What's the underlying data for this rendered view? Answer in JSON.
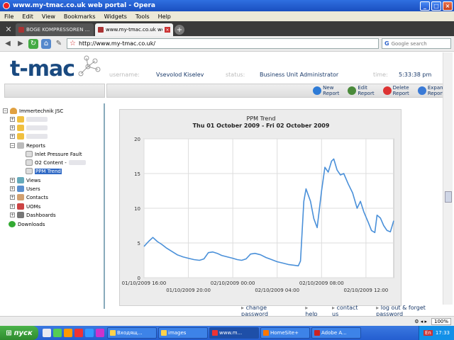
{
  "window": {
    "title": "www.my-tmac.co.uk web portal - Opera"
  },
  "menu": [
    "File",
    "Edit",
    "View",
    "Bookmarks",
    "Widgets",
    "Tools",
    "Help"
  ],
  "tabs": [
    {
      "label": "BOGE KOMPRESSOREN ..."
    },
    {
      "label": "www.my-tmac.co.uk we..."
    }
  ],
  "address": {
    "url": "http://www.my-tmac.co.uk/",
    "search_placeholder": "Google search"
  },
  "header": {
    "logo": "t-mac",
    "username_label": "username:",
    "username": "Vsevolod Kiselev",
    "status_label": "status:",
    "status": "Business Unit Administrator",
    "time_label": "time:",
    "time": "5:33:38 pm"
  },
  "actions": [
    {
      "l1": "New",
      "l2": "Report",
      "color": "#2e7bd6"
    },
    {
      "l1": "Edit",
      "l2": "Report",
      "color": "#4a8a3a"
    },
    {
      "l1": "Delete",
      "l2": "Report",
      "color": "#d33"
    },
    {
      "l1": "Expand",
      "l2": "Report",
      "color": "#3a7ad6"
    }
  ],
  "tree": {
    "root": "Immertechnik JSC",
    "reports": "Reports",
    "report_items": [
      "Inlet Pressure Fault",
      "O2 Content -",
      "PPM Trend"
    ],
    "views": "Views",
    "users": "Users",
    "contacts": "Contacts",
    "uoms": "UOMs",
    "dashboards": "Dashboards",
    "downloads": "Downloads"
  },
  "chart_data": {
    "type": "line",
    "title": "PPM Trend",
    "subtitle": "Thu 01 October 2009 - Fri 02 October 2009",
    "xlabel": "",
    "ylabel": "",
    "ylim": [
      0,
      20
    ],
    "yticks": [
      0,
      5,
      10,
      15,
      20
    ],
    "xticks_top": [
      "01/10/2009 16:00",
      "02/10/2009 00:00",
      "02/10/2009 08:00"
    ],
    "xticks_bottom": [
      "01/10/2009 20:00",
      "02/10/2009 04:00",
      "02/10/2009 12:00"
    ],
    "xtick_hours": [
      16,
      20,
      24,
      28,
      32,
      36
    ],
    "xrange_hours": [
      16,
      38.5
    ],
    "grid": true,
    "series": [
      {
        "color": "#4a90d9",
        "points": [
          [
            16.0,
            4.5
          ],
          [
            16.4,
            5.2
          ],
          [
            16.8,
            5.8
          ],
          [
            17.2,
            5.2
          ],
          [
            17.6,
            4.8
          ],
          [
            18.0,
            4.3
          ],
          [
            18.5,
            3.8
          ],
          [
            19.0,
            3.3
          ],
          [
            19.5,
            3.0
          ],
          [
            20.0,
            2.8
          ],
          [
            20.5,
            2.6
          ],
          [
            21.0,
            2.5
          ],
          [
            21.4,
            2.7
          ],
          [
            21.8,
            3.6
          ],
          [
            22.2,
            3.7
          ],
          [
            22.6,
            3.5
          ],
          [
            23.0,
            3.2
          ],
          [
            23.5,
            3.0
          ],
          [
            24.0,
            2.8
          ],
          [
            24.4,
            2.6
          ],
          [
            24.8,
            2.5
          ],
          [
            25.2,
            2.7
          ],
          [
            25.6,
            3.4
          ],
          [
            26.0,
            3.5
          ],
          [
            26.5,
            3.3
          ],
          [
            27.0,
            2.9
          ],
          [
            27.5,
            2.6
          ],
          [
            28.0,
            2.3
          ],
          [
            28.5,
            2.1
          ],
          [
            29.0,
            1.9
          ],
          [
            29.5,
            1.8
          ],
          [
            29.9,
            1.7
          ],
          [
            30.1,
            2.4
          ],
          [
            30.4,
            11.0
          ],
          [
            30.6,
            12.8
          ],
          [
            31.0,
            11.0
          ],
          [
            31.3,
            8.5
          ],
          [
            31.6,
            7.2
          ],
          [
            32.0,
            12.5
          ],
          [
            32.3,
            15.9
          ],
          [
            32.6,
            15.2
          ],
          [
            32.9,
            16.8
          ],
          [
            33.1,
            17.1
          ],
          [
            33.4,
            15.5
          ],
          [
            33.7,
            14.8
          ],
          [
            34.0,
            15.0
          ],
          [
            34.4,
            13.5
          ],
          [
            34.8,
            12.2
          ],
          [
            35.2,
            10.0
          ],
          [
            35.5,
            11.0
          ],
          [
            35.8,
            9.5
          ],
          [
            36.2,
            8.0
          ],
          [
            36.5,
            6.8
          ],
          [
            36.8,
            6.5
          ],
          [
            37.0,
            9.0
          ],
          [
            37.3,
            8.6
          ],
          [
            37.6,
            7.5
          ],
          [
            37.9,
            6.8
          ],
          [
            38.2,
            6.6
          ],
          [
            38.5,
            8.2
          ]
        ]
      }
    ]
  },
  "footer_links": [
    "change password",
    "help",
    "contact us",
    "log out & forget password"
  ],
  "statusbar": {
    "zoom": "100%"
  },
  "taskbar": {
    "start": "пуск",
    "buttons": [
      "Входящ...",
      "images",
      "www.m...",
      "HomeSite+",
      "Adobe A..."
    ],
    "lang": "En",
    "clock": "17:33"
  }
}
